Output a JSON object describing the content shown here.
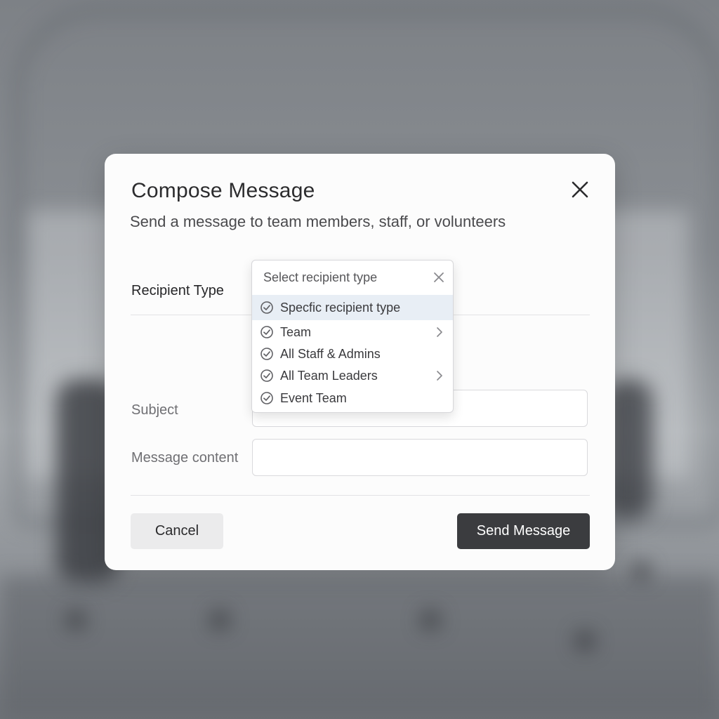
{
  "modal": {
    "title": "Compose Message",
    "subtitle": "Send a message to team members, staff, or volunteers"
  },
  "form": {
    "recipient_label": "Recipient Type",
    "subject_label": "Subject",
    "message_label": "Message content",
    "subject_value": "",
    "message_value": ""
  },
  "dropdown": {
    "placeholder": "Select recipient type",
    "options": [
      {
        "label": "Specfic recipient type",
        "highlighted": true,
        "has_submenu": false
      },
      {
        "label": "Team",
        "highlighted": false,
        "has_submenu": true
      },
      {
        "label": "All Staff & Admins",
        "highlighted": false,
        "has_submenu": false
      },
      {
        "label": "All Team Leaders",
        "highlighted": false,
        "has_submenu": true
      },
      {
        "label": "Event Team",
        "highlighted": false,
        "has_submenu": false
      }
    ]
  },
  "actions": {
    "cancel_label": "Cancel",
    "send_label": "Send Message"
  },
  "colors": {
    "primary_button": "#3b3c3f",
    "highlight": "#e8eef5"
  },
  "icons": {
    "close": "close-icon",
    "clear": "clear-icon",
    "option": "check-circle-icon",
    "submenu": "chevron-right-icon"
  }
}
